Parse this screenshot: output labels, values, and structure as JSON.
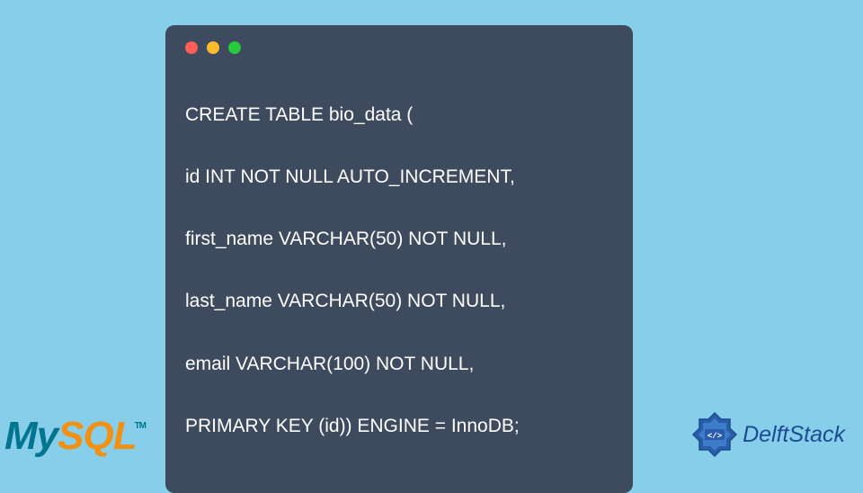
{
  "code": {
    "lines": [
      "CREATE TABLE bio_data (",
      "id INT NOT NULL AUTO_INCREMENT,",
      "first_name VARCHAR(50) NOT NULL,",
      "last_name VARCHAR(50) NOT NULL,",
      "email VARCHAR(100) NOT NULL,",
      "PRIMARY KEY (id)) ENGINE = InnoDB;"
    ]
  },
  "mysql": {
    "my": "My",
    "sql": "SQL",
    "tm": "TM"
  },
  "delft": {
    "text": "DelftStack"
  }
}
